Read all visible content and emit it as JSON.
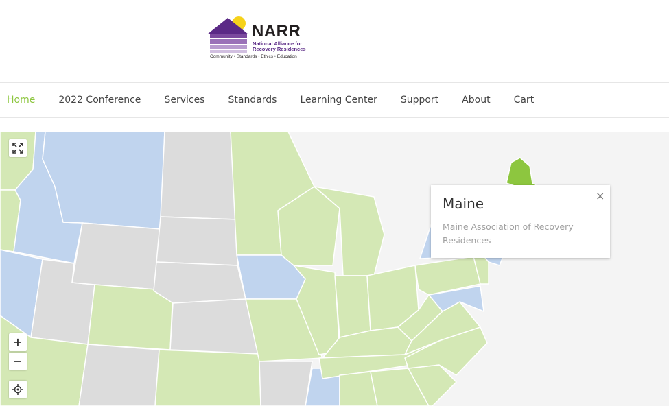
{
  "logo": {
    "name": "NARR",
    "subtitle": "National Alliance for Recovery Residences",
    "tagline": "Community • Standards • Ethics • Education"
  },
  "nav": {
    "items": [
      "Home",
      "2022 Conference",
      "Services",
      "Standards",
      "Learning Center",
      "Support",
      "About",
      "Cart"
    ],
    "active": "Home"
  },
  "map": {
    "controls": {
      "fullscreen": "fullscreen-icon",
      "zoom_in": "+",
      "zoom_out": "−",
      "locate": "locate-icon"
    },
    "colors": {
      "affiliate": "#d4e8b5",
      "pending": "#c0d4ee",
      "none": "#dcdcdc",
      "selected": "#8dc63f",
      "background": "#f4f4f4"
    },
    "popup": {
      "title": "Maine",
      "body": "Maine Association of Recovery Residences",
      "close": "×"
    }
  }
}
